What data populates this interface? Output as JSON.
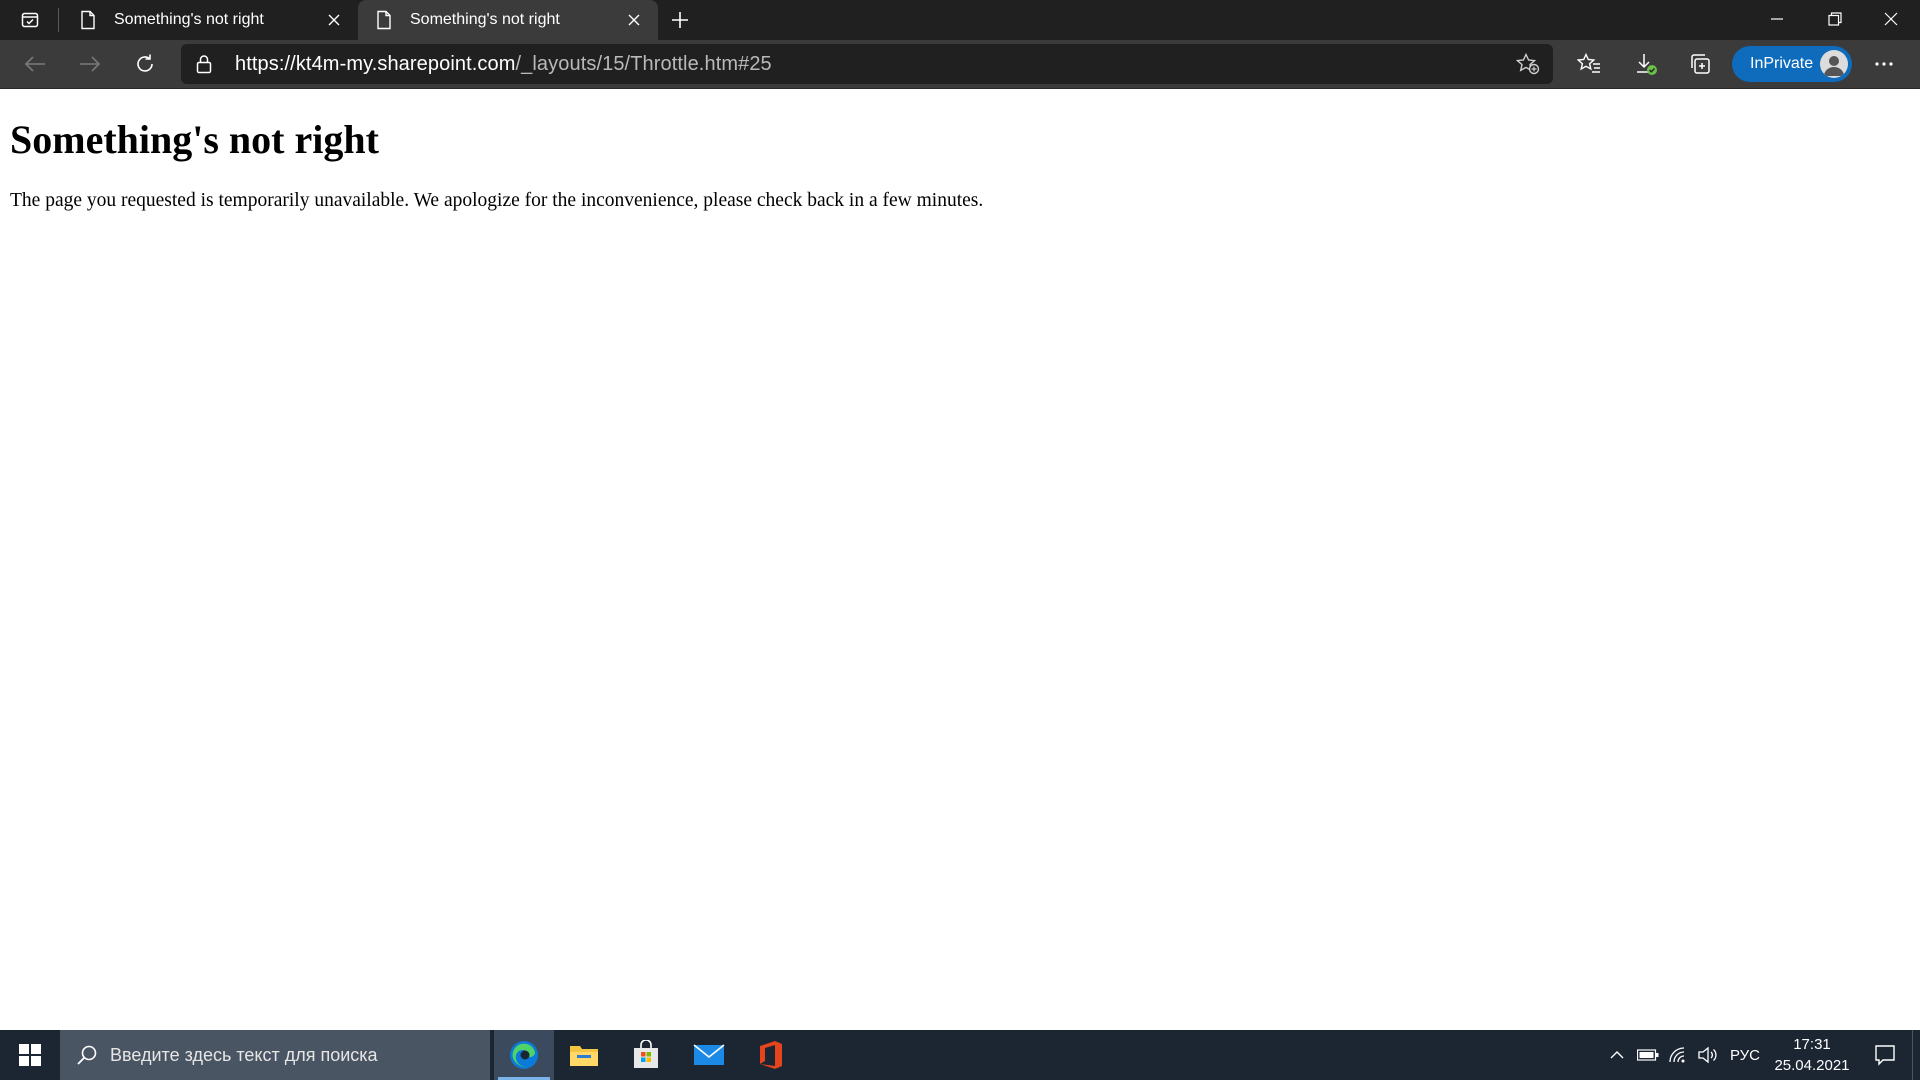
{
  "browser": {
    "tabs": [
      {
        "title": "Something's not right",
        "active": false
      },
      {
        "title": "Something's not right",
        "active": true
      }
    ],
    "address": {
      "host": "https://kt4m-my.sharepoint.com",
      "path": "/_layouts/15/Throttle.htm#25"
    },
    "inprivate_label": "InPrivate"
  },
  "page": {
    "heading": "Something's not right",
    "message": "The page you requested is temporarily unavailable. We apologize for the inconvenience, please check back in a few minutes."
  },
  "taskbar": {
    "search_placeholder": "Введите здесь текст для поиска",
    "apps": [
      "edge-icon",
      "file-explorer-icon",
      "store-icon",
      "mail-icon",
      "office-icon"
    ],
    "language": "РУС",
    "time": "17:31",
    "date": "25.04.2021"
  },
  "colors": {
    "tab_strip": "#202020",
    "toolbar": "#3b3b3b",
    "inprivate_badge": "#0f6cbd",
    "taskbar": "#1c2633",
    "taskbar_search": "#4a5564"
  }
}
